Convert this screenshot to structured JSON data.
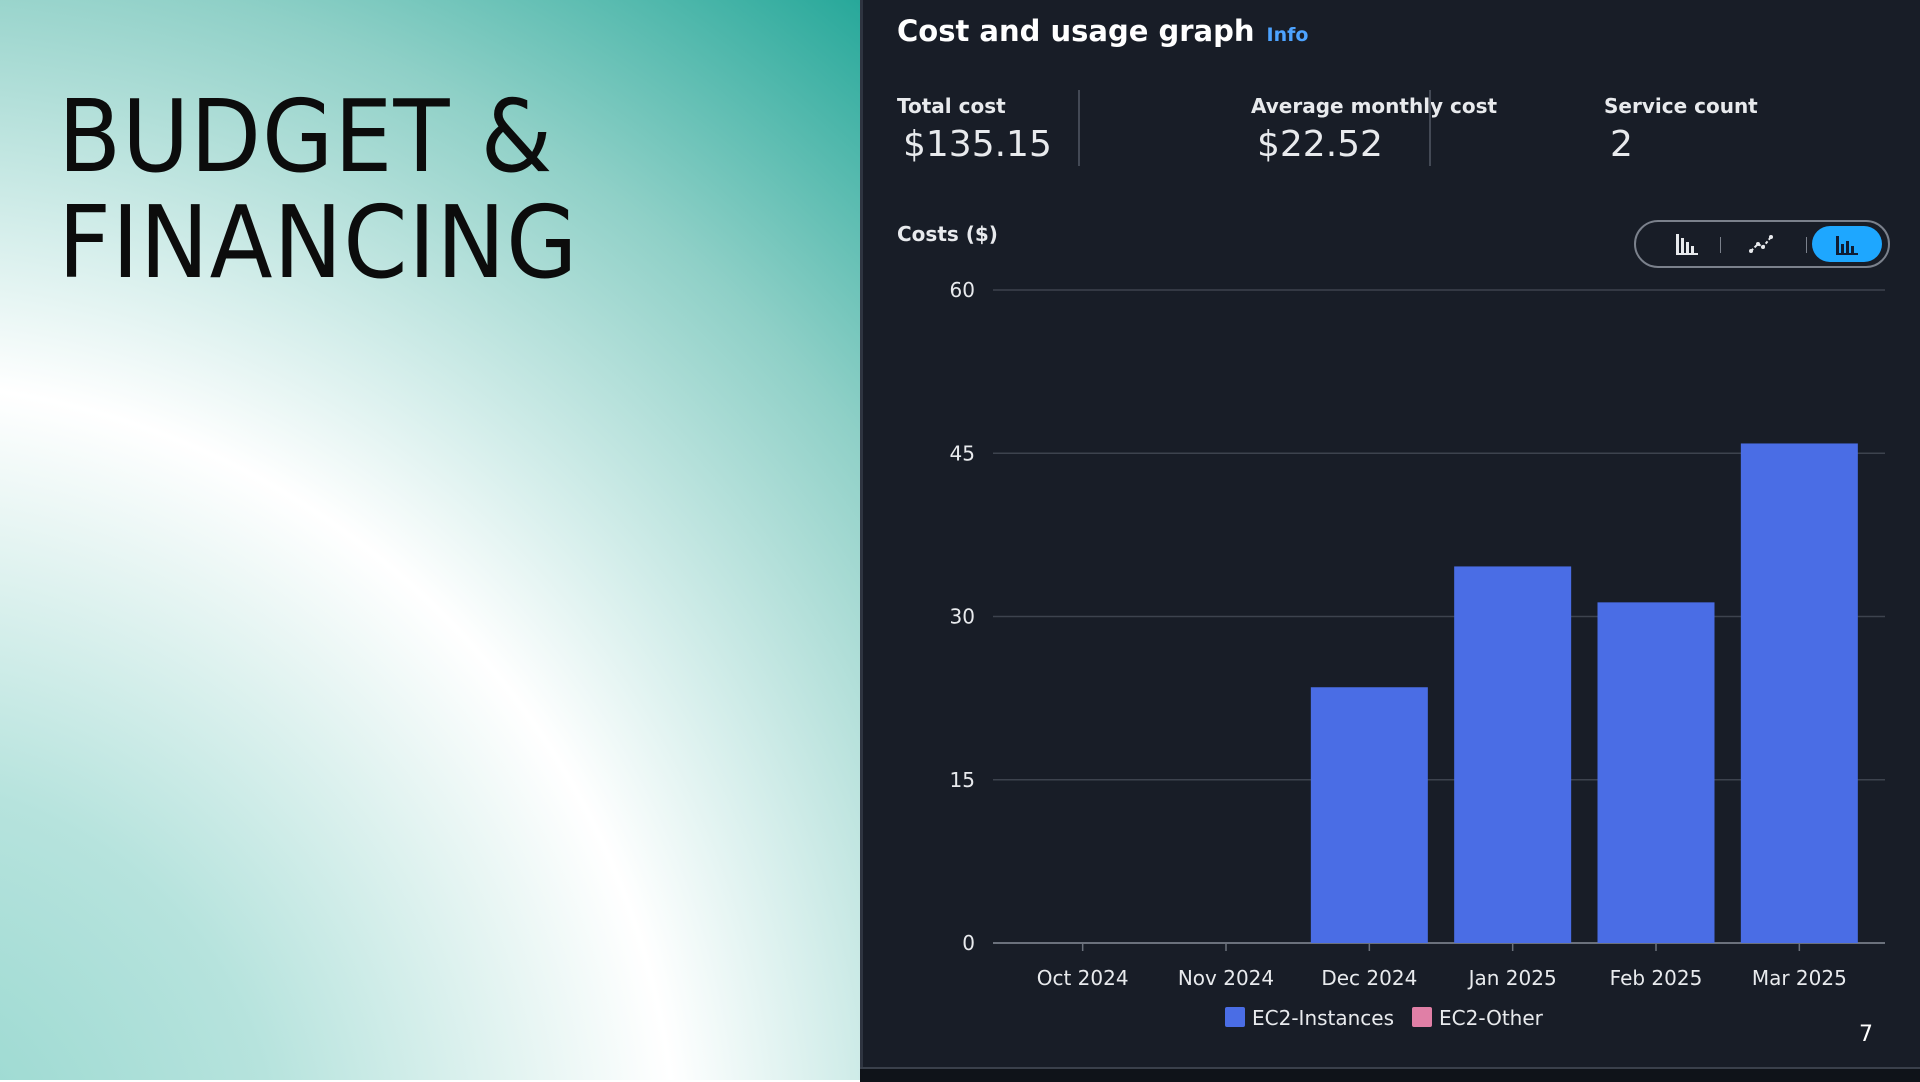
{
  "slide": {
    "title": "BUDGET &\nFINANCING",
    "page_number": "7"
  },
  "panel": {
    "title": "Cost and usage graph",
    "info_label": "Info",
    "stats": [
      {
        "label": "Total cost",
        "value": "$135.15"
      },
      {
        "label": "Average monthly cost",
        "value": "$22.52"
      },
      {
        "label": "Service count",
        "value": "2"
      }
    ],
    "chart_label": "Costs ($)",
    "chart_toggle": [
      {
        "name": "bar-chart-icon",
        "active": false
      },
      {
        "name": "line-chart-icon",
        "active": false
      },
      {
        "name": "stacked-bar-chart-icon",
        "active": true
      }
    ]
  },
  "colors": {
    "panel_bg": "#181d27",
    "accent": "#4da3ff",
    "toggle_active": "#1ea7ff",
    "series_ec2_instances": "#4a6de5",
    "series_ec2_other": "#e07fa6"
  },
  "chart_data": {
    "type": "bar",
    "stacked": true,
    "categories": [
      "Oct 2024",
      "Nov 2024",
      "Dec 2024",
      "Jan 2025",
      "Feb 2025",
      "Mar 2025"
    ],
    "series": [
      {
        "name": "EC2-Instances",
        "values": [
          0,
          0,
          23.5,
          34.6,
          31.3,
          45.9
        ]
      },
      {
        "name": "EC2-Other",
        "values": [
          0,
          0,
          0,
          0,
          0,
          0
        ]
      }
    ],
    "ylim": [
      0,
      60
    ],
    "yticks": [
      "0",
      "15",
      "30",
      "45",
      "60"
    ],
    "ytick_values": [
      0,
      15,
      30,
      45,
      60
    ],
    "ylabel": "Costs ($)",
    "xlabel": "",
    "grid": true,
    "legend_position": "bottom-center"
  }
}
